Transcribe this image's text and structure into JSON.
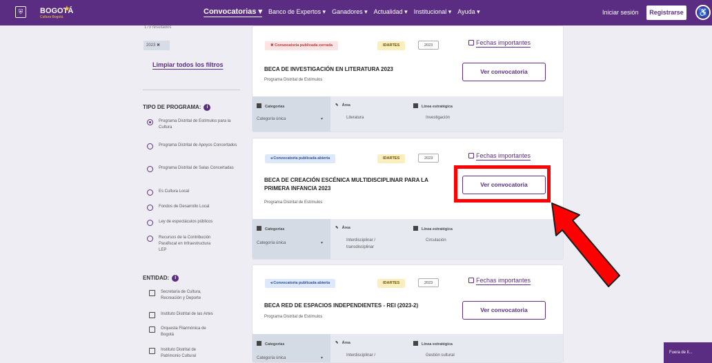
{
  "header": {
    "logo_main": "BOGOTÁ",
    "logo_sub": "Cultura Bogotá",
    "nav": [
      "Convocatorias ▾",
      "Banco de Expertos ▾",
      "Ganadores ▾",
      "Actualidad ▾",
      "Institucional ▾",
      "Ayuda ▾"
    ],
    "login": "Iniciar sesión",
    "register": "Registrarse"
  },
  "sidebar": {
    "results": "173 resultados",
    "chip": "2023 ✖",
    "clear_filters": "Limpiar todos los filtros",
    "program_title": "TIPO DE PROGRAMA:",
    "programs": [
      "Programa Distrital de Estímulos para la Cultura",
      "Programa Distrital de Apoyos Concertados",
      "Programa Distrital de Salas Concertadas",
      "Es Cultura Local",
      "Fondos de Desarrollo Local",
      "Ley de espectáculos públicos",
      "Recursos de la Contribución Parafiscal en Infraestructura LEP"
    ],
    "entity_title": "ENTIDAD:",
    "entities": [
      "Secretaría de Cultura, Recreación y Deporte",
      "Instituto Distrital de las Artes",
      "Orquesta Filarmónica de Bogotá",
      "Instituto Distrital de Patrimonio Cultural"
    ]
  },
  "cards": [
    {
      "status": "✖ Convocatoria publicada cerrada",
      "entity": "IDARTES",
      "year": "2023",
      "fechas": "Fechas importantes",
      "title": "BECA DE INVESTIGACIÓN EN LITERATURA 2023",
      "program": "Programa Distrital de Estímulos",
      "button": "Ver convocatoria",
      "cat_label": "Categorías",
      "cat_value": "Categoría única",
      "area_label": "Área",
      "area_value": "Literatura",
      "linea_label": "Línea estratégica",
      "linea_value": "Investigación"
    },
    {
      "status": "◂ Convocatoria publicada abierta",
      "entity": "IDARTES",
      "year": "2023",
      "fechas": "Fechas importantes",
      "title": "BECA DE CREACIÓN ESCÉNICA MULTIDISCIPLINAR PARA LA PRIMERA INFANCIA 2023",
      "program": "Programa Distrital de Estímulos",
      "button": "Ver convocatoria",
      "cat_label": "Categorías",
      "cat_value": "Categoría única",
      "area_label": "Área",
      "area_value": "Interdisciplinar / transdisciplinar",
      "linea_label": "Línea estratégica",
      "linea_value": "Circulación"
    },
    {
      "status": "◂ Convocatoria publicada abierta",
      "entity": "IDARTES",
      "year": "2023",
      "fechas": "Fechas importantes",
      "title": "BECA RED DE ESPACIOS INDEPENDIENTES - REI (2023-2)",
      "program": "Programa Distrital de Estímulos",
      "button": "Ver convocatoria",
      "cat_label": "Categorías",
      "cat_value": "Categoría única",
      "area_label": "Área",
      "area_value": "Interdisciplinar /",
      "linea_label": "Línea estratégica",
      "linea_value": "Gestión cultural"
    }
  ],
  "fuera": "Fuera de lí...",
  "colors": {
    "brand": "#5a2d82",
    "highlight": "#ff0000"
  }
}
